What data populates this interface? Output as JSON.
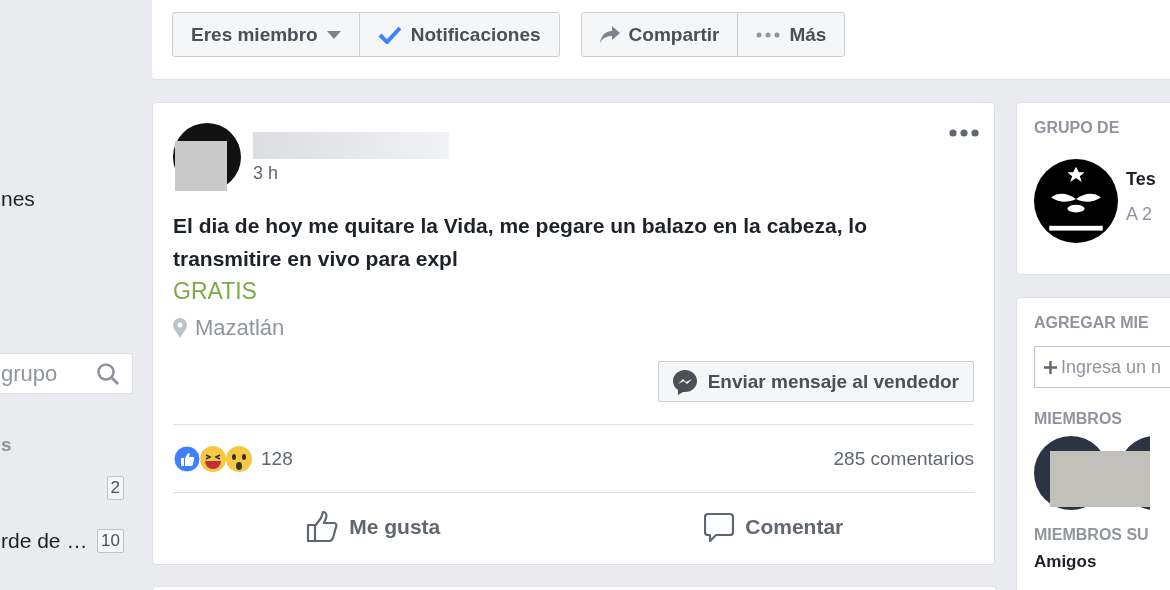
{
  "sidebar": {
    "items": [
      {
        "label": "nes"
      }
    ],
    "search": {
      "placeholder": "grupo"
    },
    "section_label": "s",
    "groups": [
      {
        "count": "2"
      },
      {
        "name": "rde de …",
        "count": "10"
      }
    ]
  },
  "group_actions": [
    [
      {
        "label": "Eres miembro",
        "kind": "dropdown"
      },
      {
        "label": "Notificaciones",
        "kind": "check"
      }
    ],
    [
      {
        "label": "Compartir",
        "kind": "share"
      },
      {
        "label": "Más",
        "kind": "more"
      }
    ]
  ],
  "post": {
    "time": "3 h",
    "text": "El dia de hoy me quitare la Vida, me pegare un balazo en la cabeza, lo transmitire en vivo para expl",
    "price": "GRATIS",
    "location": "Mazatlán",
    "message_button": "Enviar mensaje al vendedor",
    "reaction_count": "128",
    "comments": "285 comentarios",
    "actions": [
      {
        "label": "Me gusta",
        "kind": "like"
      },
      {
        "label": "Comentar",
        "kind": "comment"
      }
    ]
  },
  "right": {
    "group_card": {
      "heading": "GRUPO DE",
      "name": "Tes",
      "subtitle": "A 2"
    },
    "add_members": {
      "heading": "AGREGAR MIE",
      "placeholder": "Ingresa un n"
    },
    "members_heading": "MIEMBROS",
    "suggested_heading": "MIEMBROS SU",
    "suggested_label": "Amigos"
  }
}
